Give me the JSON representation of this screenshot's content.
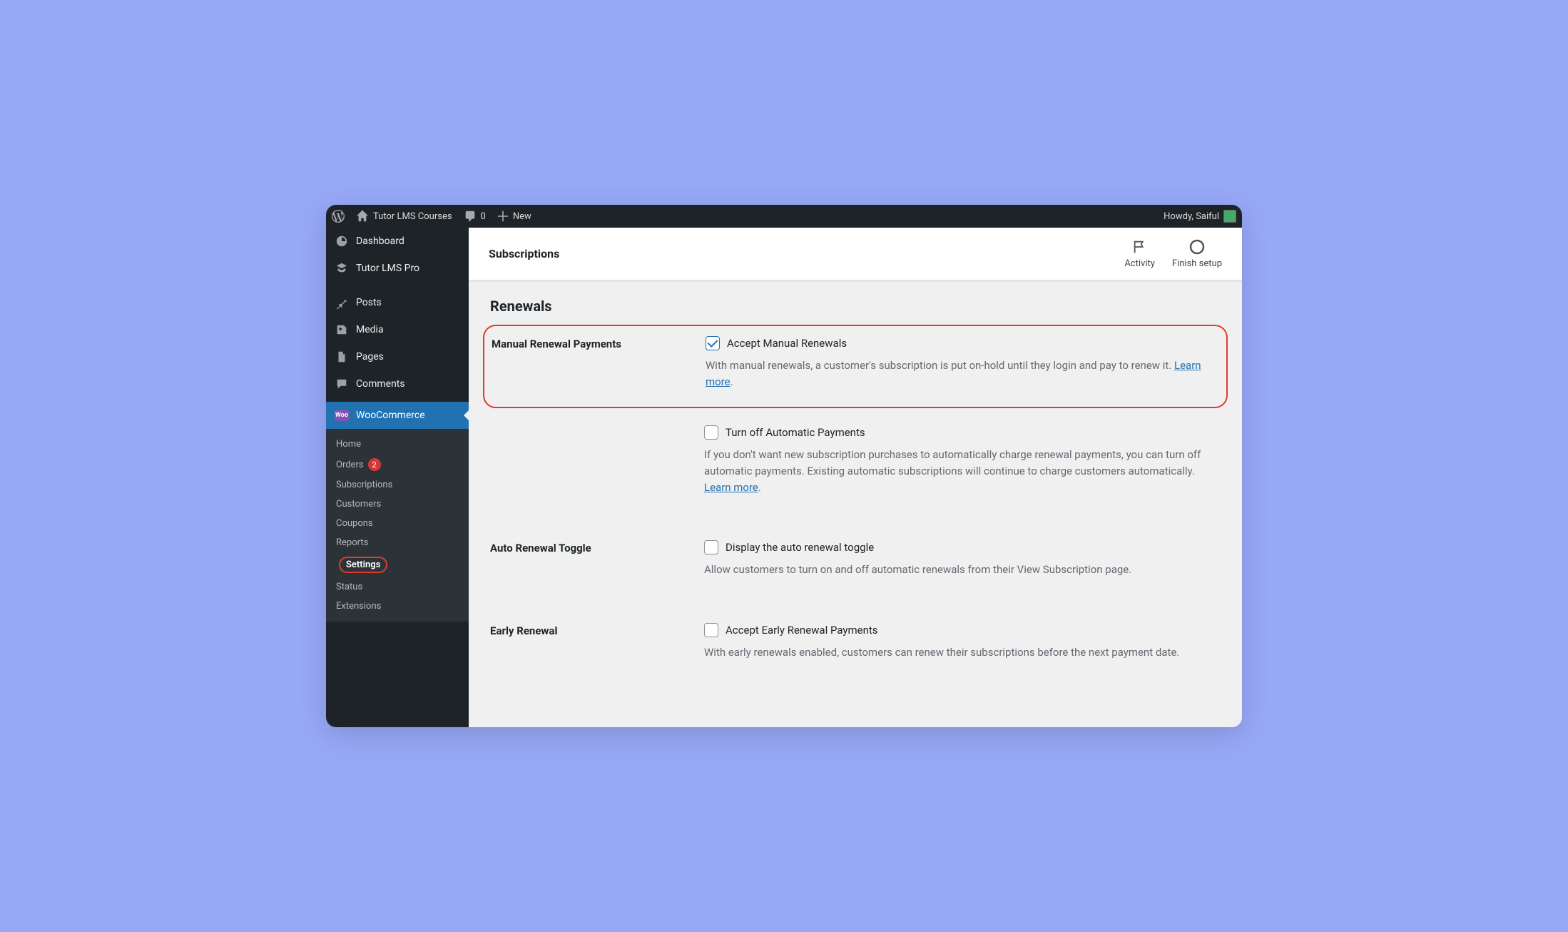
{
  "adminbar": {
    "site_title": "Tutor LMS Courses",
    "comments": "0",
    "new_label": "New",
    "howdy": "Howdy, Saiful"
  },
  "sidebar": {
    "dashboard": "Dashboard",
    "tutor_pro": "Tutor LMS Pro",
    "posts": "Posts",
    "media": "Media",
    "pages": "Pages",
    "comments": "Comments",
    "woocommerce": "WooCommerce",
    "woo_badge": "Woo",
    "sub": {
      "home": "Home",
      "orders": "Orders",
      "orders_count": "2",
      "subscriptions": "Subscriptions",
      "customers": "Customers",
      "coupons": "Coupons",
      "reports": "Reports",
      "settings": "Settings",
      "status": "Status",
      "extensions": "Extensions"
    }
  },
  "topbar": {
    "title": "Subscriptions",
    "activity": "Activity",
    "finish_setup": "Finish setup"
  },
  "renewals": {
    "heading": "Renewals",
    "manual": {
      "label": "Manual Renewal Payments",
      "checkbox": "Accept Manual Renewals",
      "desc1": "With manual renewals, a customer's subscription is put on-hold until they login and pay to renew it. ",
      "learn": "Learn more",
      "turnoff_checkbox": "Turn off Automatic Payments",
      "turnoff_desc": "If you don't want new subscription purchases to automatically charge renewal payments, you can turn off automatic payments. Existing automatic subscriptions will continue to charge customers automatically. "
    },
    "auto_toggle": {
      "label": "Auto Renewal Toggle",
      "checkbox": "Display the auto renewal toggle",
      "desc": "Allow customers to turn on and off automatic renewals from their View Subscription page."
    },
    "early": {
      "label": "Early Renewal",
      "checkbox": "Accept Early Renewal Payments",
      "desc": "With early renewals enabled, customers can renew their subscriptions before the next payment date."
    }
  }
}
